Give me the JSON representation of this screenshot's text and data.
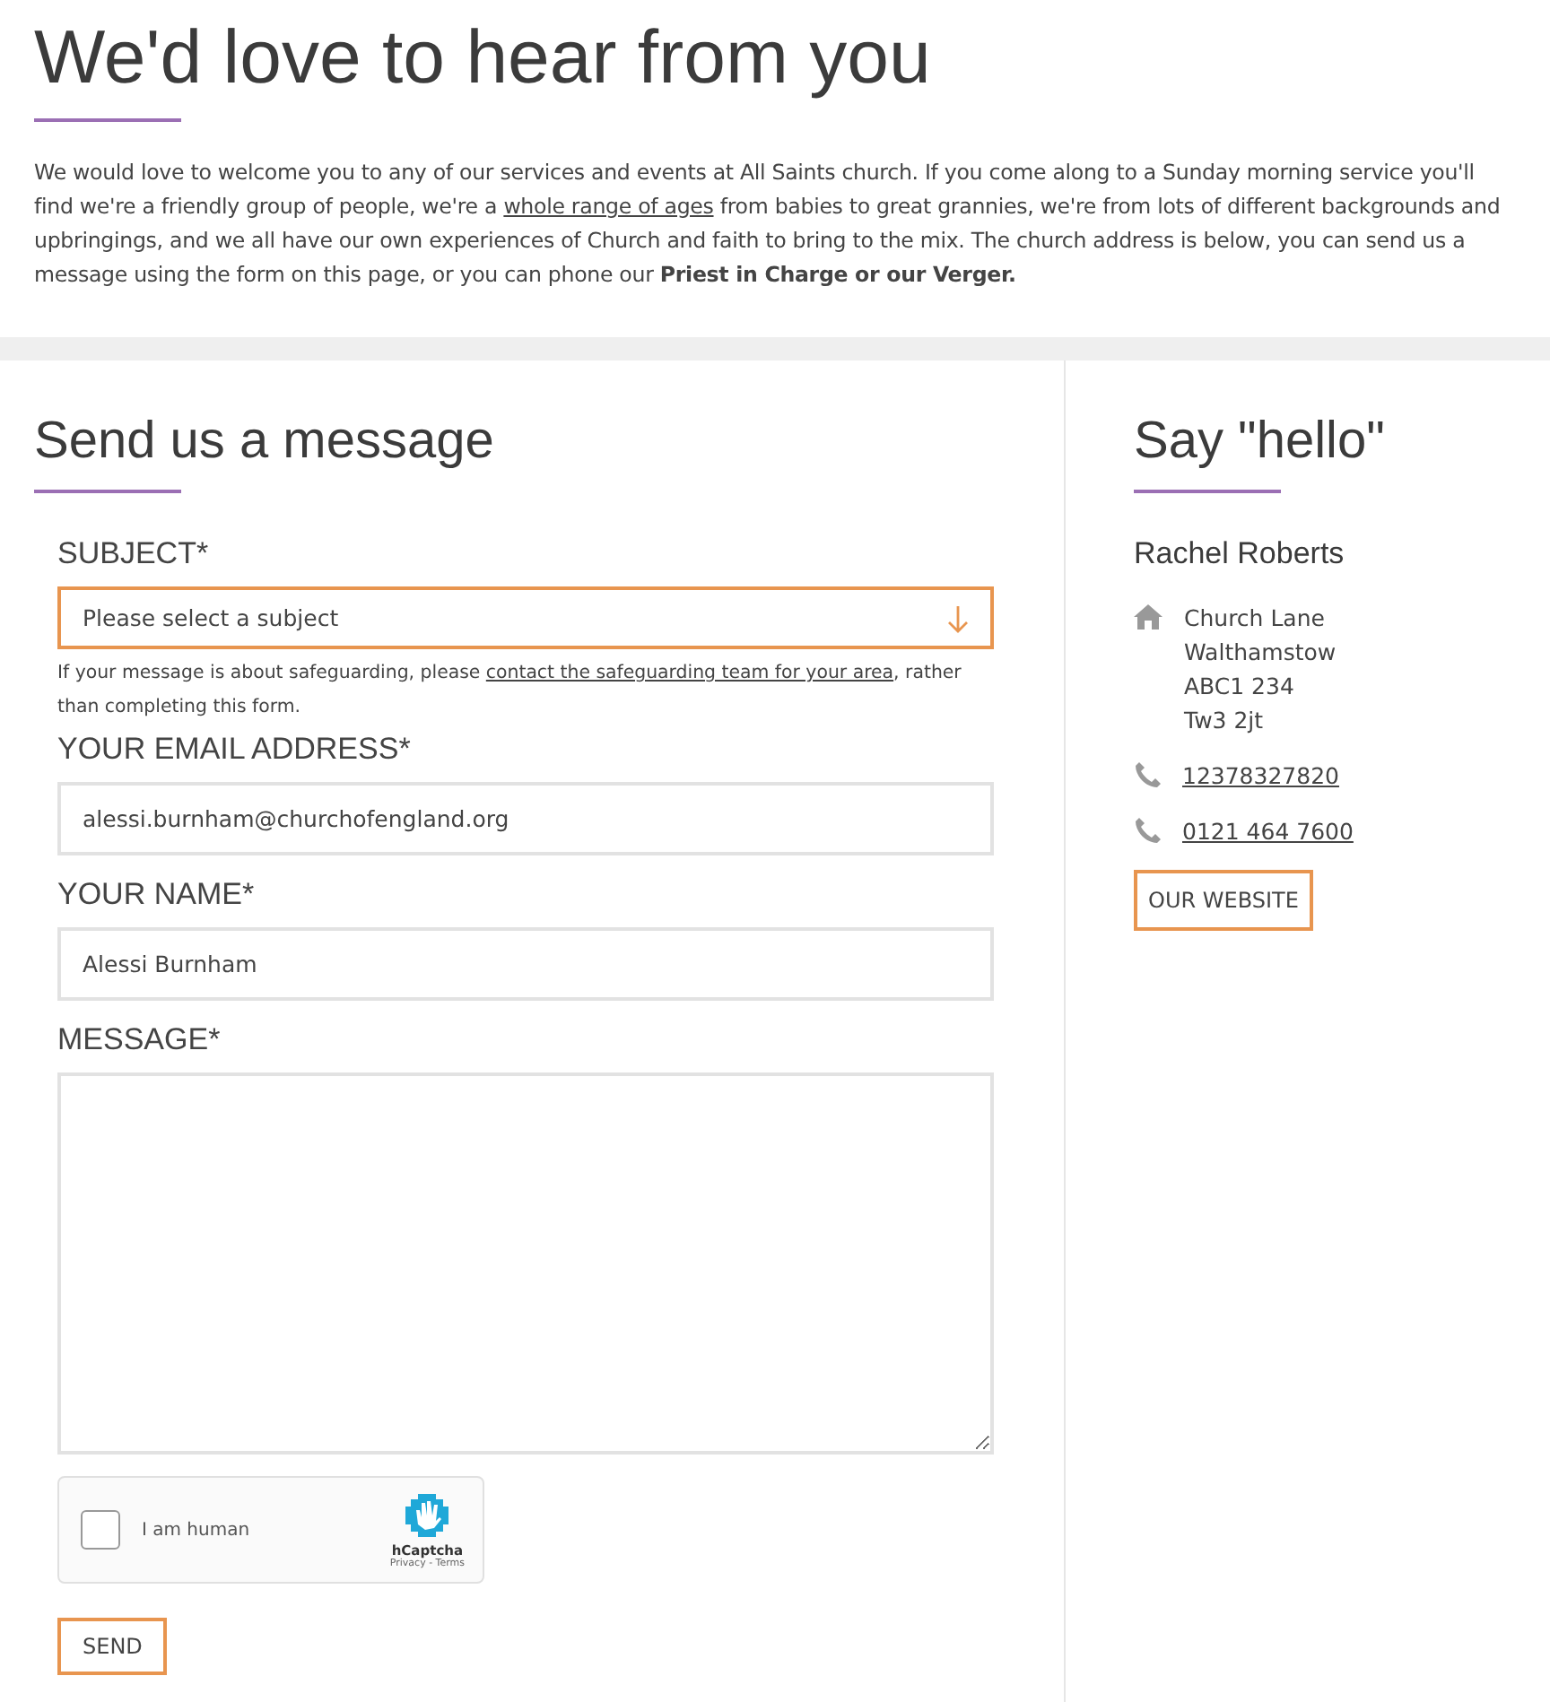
{
  "title": "We'd love to hear from you",
  "intro": {
    "before": "We would love to welcome you to any of our services and events at All Saints church. If you come along to a Sunday morning service you'll find we're a friendly group of people, we're a ",
    "link": "whole range of ages",
    "after": " from babies to great grannies, we're from lots of different backgrounds and upbringings, and we all have our own experiences of Church and faith to bring to the mix. The church address is below, you can send us a message using the form on this page, or you can phone our **Priest in Charge or our Verger.**"
  },
  "form": {
    "title": "Send us a message",
    "subject": {
      "label": "SUBJECT*",
      "placeholder": "Please select a subject"
    },
    "note": {
      "before": "If your message is about safeguarding, please ",
      "link": "contact the safeguarding team for your area",
      "after": ", rather than completing this form."
    },
    "fields": [
      {
        "kind": "input",
        "label": "YOUR EMAIL ADDRESS*",
        "value": "alessi.burnham@churchofengland.org"
      },
      {
        "kind": "input",
        "label": "YOUR NAME*",
        "value": "Alessi Burnham"
      },
      {
        "kind": "textarea",
        "label": "MESSAGE*"
      }
    ],
    "captcha": {
      "label": "I am human",
      "checked": false,
      "brand": "hCaptcha",
      "links": "Privacy - Terms"
    },
    "submit": "SEND"
  },
  "contact": {
    "title": "Say \"hello\"",
    "name": "Rachel Roberts",
    "address": [
      "Church Lane",
      "Walthamstow",
      "ABC1 234",
      "Tw3 2jt"
    ],
    "phones": [
      "12378327820",
      "0121 464 7600"
    ],
    "website": "OUR WEBSITE"
  }
}
